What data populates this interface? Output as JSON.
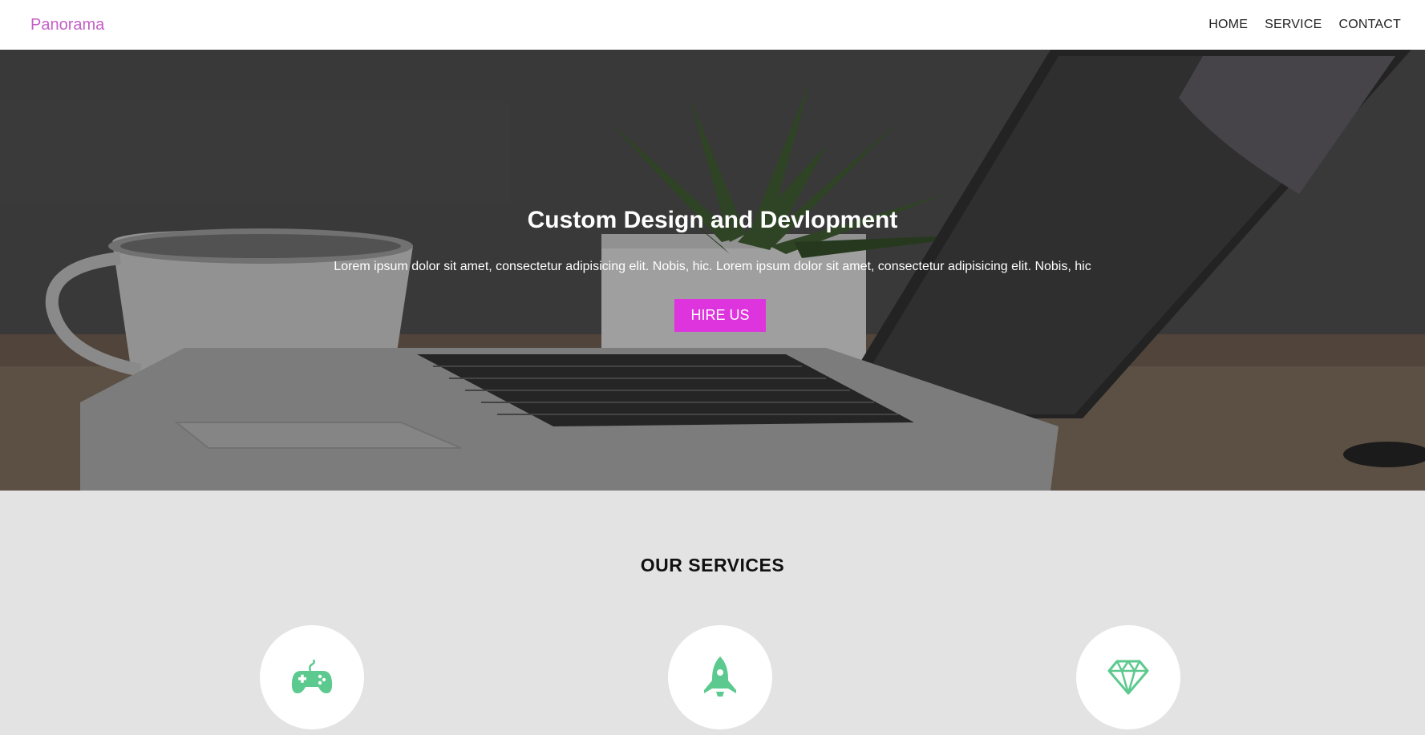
{
  "navbar": {
    "brand": "Panorama",
    "brand_color": "#c35fc7",
    "links": [
      {
        "label": "HOME"
      },
      {
        "label": "SERVICE"
      },
      {
        "label": "CONTACT"
      }
    ]
  },
  "hero": {
    "title": "Custom Design and Devlopment",
    "text": "Lorem ipsum dolor sit amet, consectetur adipisicing elit. Nobis, hic. Lorem ipsum dolor sit amet, consectetur adipisicing elit. Nobis, hic",
    "button_label": "HIRE US",
    "button_color": "#de34de"
  },
  "services": {
    "title": "OUR SERVICES",
    "icon_color": "#5cc98e",
    "items": [
      {
        "icon": "gamepad-icon"
      },
      {
        "icon": "rocket-icon"
      },
      {
        "icon": "diamond-icon"
      }
    ]
  }
}
